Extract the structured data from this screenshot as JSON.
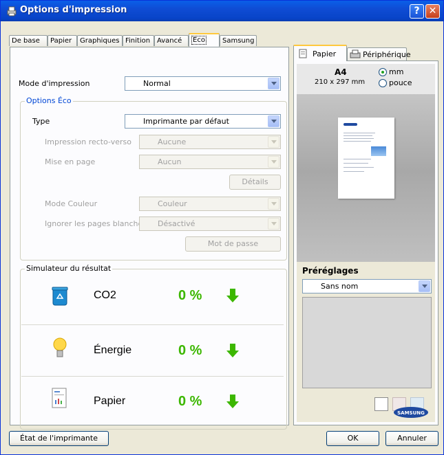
{
  "window": {
    "title": "Options d'impression",
    "help_label": "?",
    "close_label": "✕"
  },
  "tabs": [
    "De base",
    "Papier",
    "Graphiques",
    "Finition",
    "Avancé",
    "Éco",
    "Samsung"
  ],
  "active_tab": "Éco",
  "print_mode": {
    "label": "Mode d'impression",
    "value": "Normal"
  },
  "eco_options": {
    "title": "Options Éco",
    "type": {
      "label": "Type",
      "value": "Imprimante par défaut"
    },
    "duplex": {
      "label": "Impression recto-verso",
      "value": "Aucune"
    },
    "layout": {
      "label": "Mise en page",
      "value": "Aucun"
    },
    "details_button": "Détails",
    "color_mode": {
      "label": "Mode Couleur",
      "value": "Couleur"
    },
    "skip_blank": {
      "label": "Ignorer les pages blanches",
      "value": "Désactivé"
    },
    "password_button": "Mot de passe"
  },
  "simulator": {
    "title": "Simulateur du résultat",
    "rows": [
      {
        "name": "CO2",
        "value": "0 %"
      },
      {
        "name": "Énergie",
        "value": "0 %"
      },
      {
        "name": "Papier",
        "value": "0 %"
      }
    ]
  },
  "right_tabs": [
    "Papier",
    "Périphérique"
  ],
  "paper": {
    "size": "A4",
    "dims": "210 x 297 mm",
    "unit_mm": "mm",
    "unit_inch": "pouce",
    "selected_unit": "mm"
  },
  "presets": {
    "title": "Préréglages",
    "value": "Sans nom"
  },
  "brand": "SAMSUNG",
  "footer": {
    "printer_status": "État de l'imprimante",
    "ok": "OK",
    "cancel": "Annuler"
  },
  "colors": {
    "titlebar": "#0a5fe8",
    "eco_green": "#3cb700",
    "group_title": "#0046d5"
  }
}
